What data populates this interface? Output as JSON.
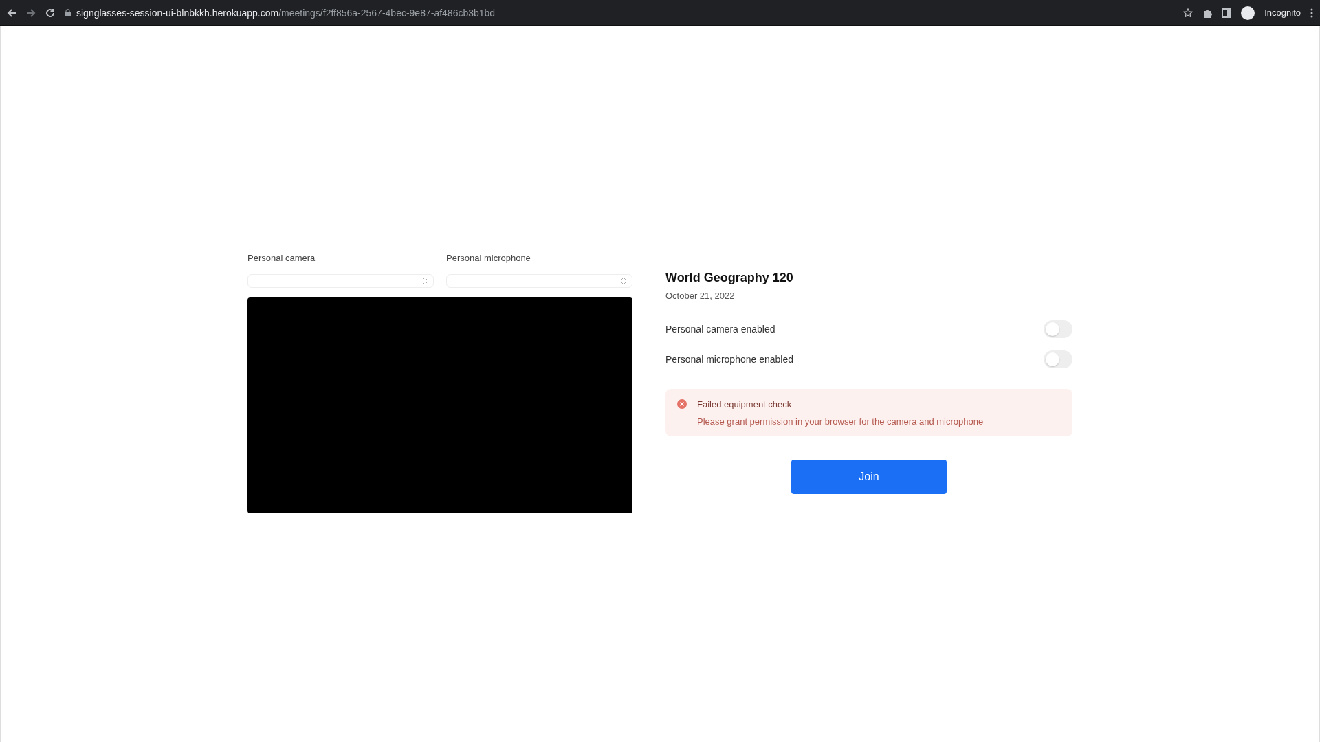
{
  "browser": {
    "url_host": "signglasses-session-ui-blnbkkh.herokuapp.com",
    "url_path": "/meetings/f2ff856a-2567-4bec-9e87-af486cb3b1bd",
    "profile": "Incognito"
  },
  "devices": [
    {
      "label": "Personal camera"
    },
    {
      "label": "Personal microphone"
    }
  ],
  "meeting": {
    "title": "World Geography 120",
    "date": "October 21, 2022"
  },
  "toggles": [
    {
      "label": "Personal camera enabled",
      "on": false
    },
    {
      "label": "Personal microphone enabled",
      "on": false
    }
  ],
  "alert": {
    "title": "Failed equipment check",
    "message": "Please grant permission in your browser for the camera and microphone"
  },
  "join_button": "Join"
}
